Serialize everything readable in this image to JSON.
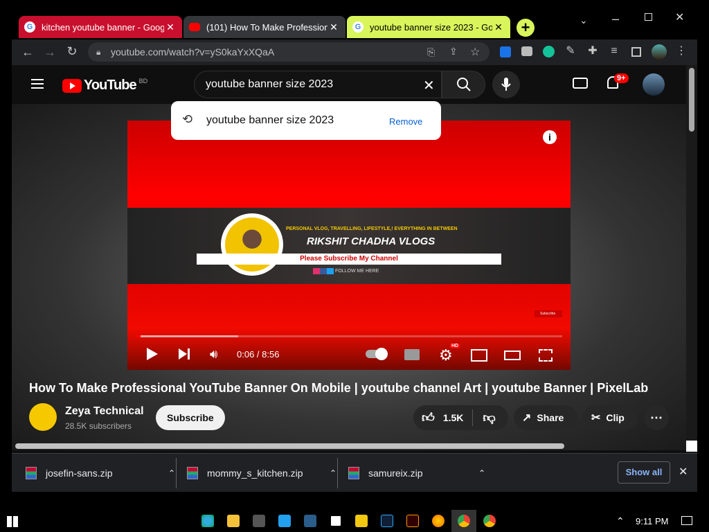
{
  "tabs": [
    {
      "title": "kitchen youtube banner - Google",
      "active": false
    },
    {
      "title": "(101) How To Make Professional",
      "active": true
    },
    {
      "title": "youtube banner size 2023 - Goo",
      "active": false
    }
  ],
  "address": {
    "url": "youtube.com/watch?v=yS0kaYxXQaA"
  },
  "youtube": {
    "logo_text": "YouTube",
    "region": "BD",
    "search_value": "youtube banner size 2023",
    "suggestion": {
      "text": "youtube banner size 2023",
      "remove_label": "Remove"
    },
    "notifications_badge": "9+",
    "video": {
      "banner_tagline": "PERSONAL VLOG, TRAVELLING, LIFESTYLE,! EVERYTHING IN BETWEEN",
      "banner_name": "RIKSHIT CHADHA VLOGS",
      "banner_ribbon": "Please Subscribe My Channel",
      "banner_follow": "FOLLOW ME HERE",
      "subscribe_sticker": "Subscribe",
      "time": "0:06 / 8:56",
      "progress": 0.011,
      "buffered": 0.24
    },
    "title": "How To Make Professional YouTube Banner On Mobile | youtube channel Art | youtube Banner | PixelLab",
    "channel": {
      "name": "Zeya Technical",
      "subscribers": "28.5K subscribers"
    },
    "subscribe_label": "Subscribe",
    "likes": "1.5K",
    "share_label": "Share",
    "clip_label": "Clip"
  },
  "downloads": {
    "items": [
      "josefin-sans.zip",
      "mommy_s_kitchen.zip",
      "samureix.zip"
    ],
    "show_all": "Show all"
  },
  "taskbar": {
    "time": "9:11 PM"
  },
  "colors": {
    "yt_red": "#ff0000",
    "chrome_dark": "#202124",
    "active_tab": "#35363a",
    "left_tab": "#d2101e",
    "right_tab": "#d6ff5a"
  }
}
